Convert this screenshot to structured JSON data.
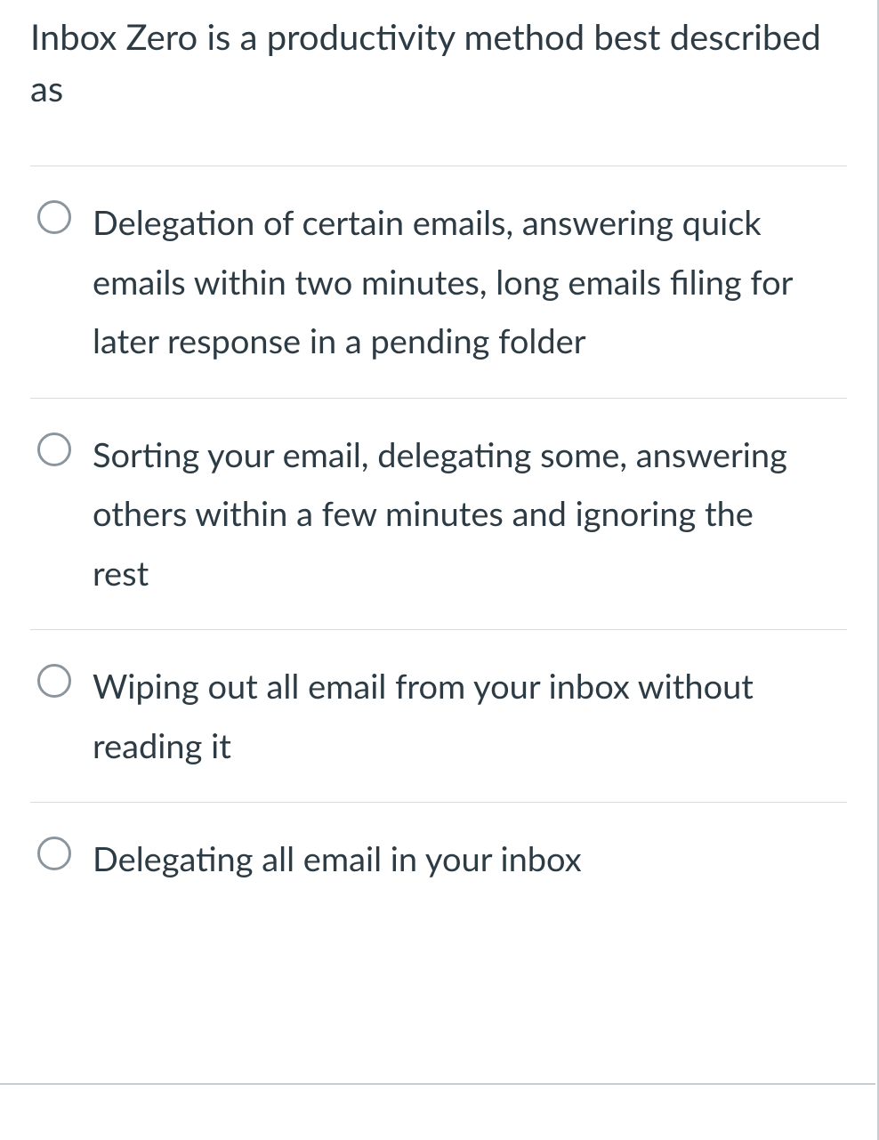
{
  "question": {
    "prompt": "Inbox Zero is a productivity method best described as",
    "options": [
      {
        "text": "Delegation of certain emails, answering quick emails within two minutes, long emails filing for later response in a pending folder"
      },
      {
        "text": "Sorting your email, delegating some, answering others within a few minutes and ignoring the rest"
      },
      {
        "text": "Wiping out all email from your inbox without reading it"
      },
      {
        "text": "Delegating all email in your inbox"
      }
    ]
  }
}
